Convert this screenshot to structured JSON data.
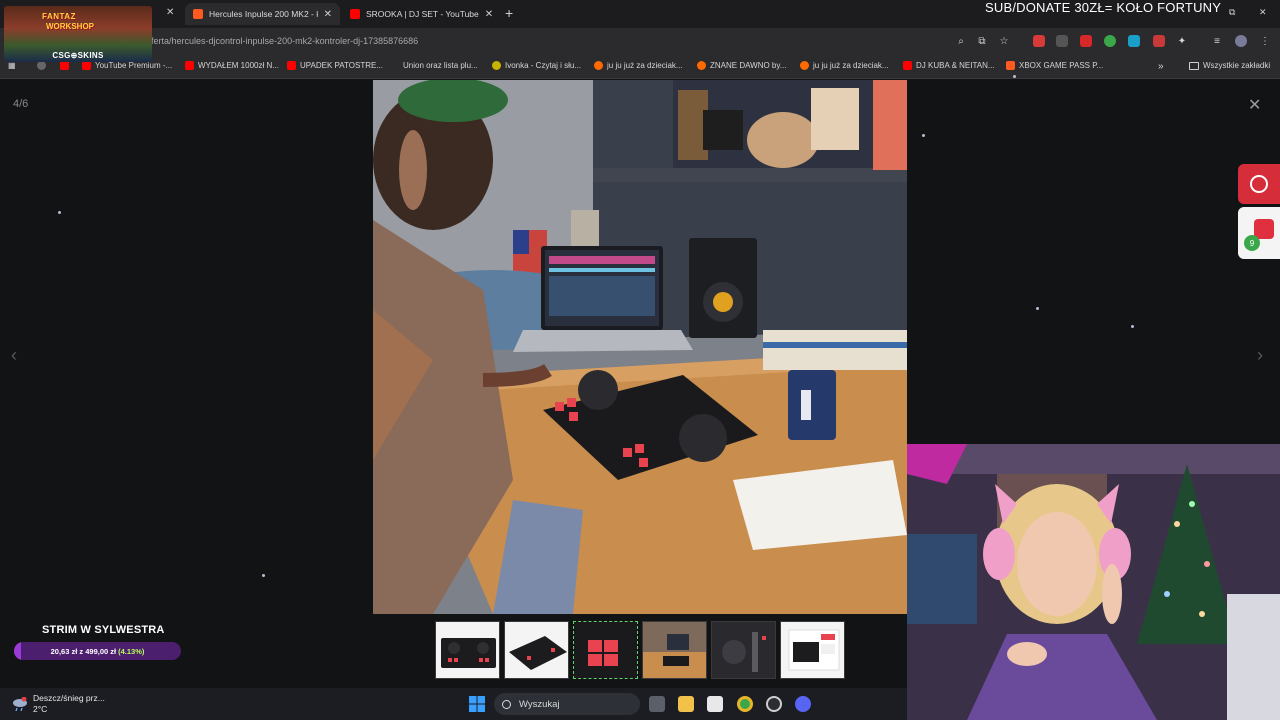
{
  "stream_overlay": {
    "donate_banner": "SUB/DONATE 30ZŁ= KOŁO FORTUNY",
    "logo_line1": "FANTAZ",
    "logo_line2": "WORKSHOP",
    "logo_skins": "CSG⊕SKINS"
  },
  "tabs": [
    {
      "label": "Hercules Inpulse 200 MK2 - kon",
      "color": "#ff5a1f",
      "active": true
    },
    {
      "label": "SROOKA | DJ SET - YouTube",
      "color": "#ff0000",
      "active": false
    }
  ],
  "address_bar": {
    "url": "ferta/hercules-djcontrol-inpulse-200-mk2-kontroler-dj-17385876686"
  },
  "bookmarks": [
    {
      "label": "YouTube Premium -...",
      "color": "#ff0000"
    },
    {
      "label": "WYDAŁEM 1000zł N...",
      "color": "#ff0000"
    },
    {
      "label": "UPADEK PATOSTRE...",
      "color": "#ff0000"
    },
    {
      "label": "Union oraz lista plu...",
      "color": "#2b2b2d"
    },
    {
      "label": "Ivonka - Czytaj i słu...",
      "color": "#c8b400"
    },
    {
      "label": "ju ju już za dzieciak...",
      "color": "#ff6a00"
    },
    {
      "label": "ZNANE DAWNO by...",
      "color": "#ff6a00"
    },
    {
      "label": "ju ju już za dzieciak...",
      "color": "#ff6a00"
    },
    {
      "label": "DJ KUBA & NEITAN...",
      "color": "#ff0000"
    },
    {
      "label": "XBOX GAME PASS P...",
      "color": "#ff5a1f"
    }
  ],
  "bookmarks_more": "»",
  "all_bookmarks": "Wszystkie zakładki",
  "viewer": {
    "counter": "4/6",
    "close": "✕",
    "prev": "‹",
    "next": "›",
    "thumbnail_count": 6,
    "active_thumbnail": 3
  },
  "goal": {
    "title": "STRIM W SYLWESTRA",
    "amount": "20,63 zł z 499,00 zł",
    "percent": "(4.13%)",
    "progress": 0.0413
  },
  "side_badges": {
    "count": "9"
  },
  "taskbar": {
    "weather_line1": "Deszcz/śnieg prz...",
    "weather_line2": "2°C",
    "search_placeholder": "Wyszukaj"
  }
}
